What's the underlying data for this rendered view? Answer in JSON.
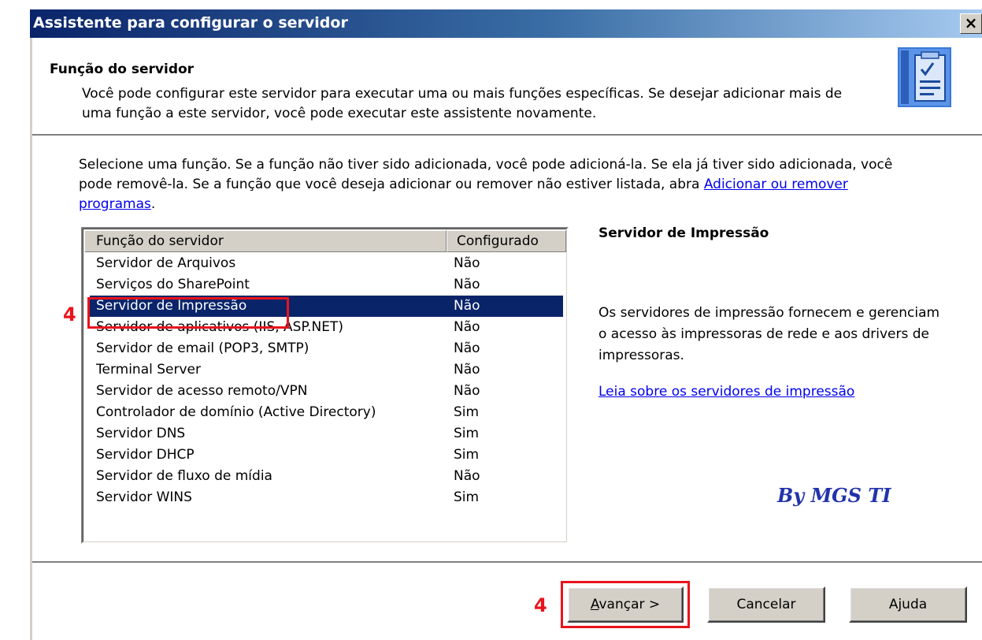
{
  "window": {
    "title": "Assistente para configurar o servidor",
    "close_glyph": "×"
  },
  "header": {
    "title": "Função do servidor",
    "description": "Você pode configurar este servidor para executar uma ou mais funções específicas. Se desejar adicionar mais de uma função a este servidor, você pode executar este assistente novamente.",
    "icon": "wizard-checklist-icon"
  },
  "instructions": {
    "text": "Selecione uma função. Se a função não tiver sido adicionada, você pode adicioná-la. Se ela já tiver sido adicionada, você pode removê-la. Se a função que você deseja adicionar ou remover não estiver listada, abra",
    "link": "Adicionar ou remover programas",
    "suffix": "."
  },
  "roles_table": {
    "columns": [
      "Função do servidor",
      "Configurado"
    ],
    "rows": [
      {
        "name": "Servidor de Arquivos",
        "configured": "Não"
      },
      {
        "name": "Serviços do SharePoint",
        "configured": "Não"
      },
      {
        "name": "Servidor de Impressão",
        "configured": "Não",
        "selected": true
      },
      {
        "name": "Servidor de aplicativos (IIS, ASP.NET)",
        "configured": "Não"
      },
      {
        "name": "Servidor de email (POP3, SMTP)",
        "configured": "Não"
      },
      {
        "name": "Terminal Server",
        "configured": "Não"
      },
      {
        "name": "Servidor de acesso remoto/VPN",
        "configured": "Não"
      },
      {
        "name": "Controlador de domínio (Active Directory)",
        "configured": "Sim"
      },
      {
        "name": "Servidor DNS",
        "configured": "Sim"
      },
      {
        "name": "Servidor DHCP",
        "configured": "Sim"
      },
      {
        "name": "Servidor de fluxo de mídia",
        "configured": "Não"
      },
      {
        "name": "Servidor WINS",
        "configured": "Sim"
      }
    ]
  },
  "details": {
    "title": "Servidor de Impressão",
    "description": "Os servidores de impressão fornecem e gerenciam o acesso às impressoras de rede e aos drivers de impressoras.",
    "link": "Leia sobre os servidores de impressão"
  },
  "annotations": {
    "step_row": "4",
    "step_button": "4",
    "color": "#e8141c"
  },
  "watermark": "By MGS TI",
  "buttons": {
    "next_accel": "A",
    "next_rest": "vançar >",
    "cancel": "Cancelar",
    "help": "Ajuda"
  },
  "colors": {
    "selection": "#0a246a",
    "title_bar_start": "#0a246a",
    "link": "#0000ee",
    "face": "#d4d0c8"
  }
}
